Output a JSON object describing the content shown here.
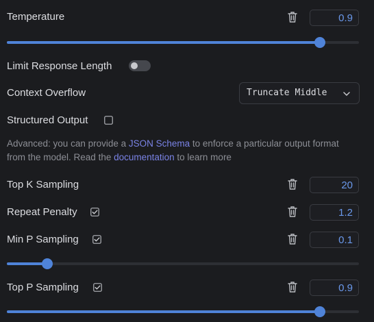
{
  "temperature": {
    "label": "Temperature",
    "value": "0.9",
    "slider_fraction": 0.89
  },
  "limit_response": {
    "label": "Limit Response Length",
    "enabled": false
  },
  "context_overflow": {
    "label": "Context Overflow",
    "selected": "Truncate Middle"
  },
  "structured_output": {
    "label": "Structured Output",
    "checked": false,
    "help_prefix": "Advanced: you can provide a ",
    "help_link1": "JSON Schema",
    "help_middle": " to enforce a particular output format from the model. Read the ",
    "help_link2": "documentation",
    "help_suffix": " to learn more"
  },
  "top_k": {
    "label": "Top K Sampling",
    "value": "20"
  },
  "repeat_penalty": {
    "label": "Repeat Penalty",
    "value": "1.2",
    "checked": true
  },
  "min_p": {
    "label": "Min P Sampling",
    "value": "0.1",
    "checked": true,
    "slider_fraction": 0.115
  },
  "top_p": {
    "label": "Top P Sampling",
    "value": "0.9",
    "checked": true,
    "slider_fraction": 0.89
  },
  "colors": {
    "accent": "#4f83d8",
    "link": "#7a83e6",
    "value_text": "#6a98ea",
    "background": "#1b1c1f"
  },
  "icons": {
    "delete": "trash-icon",
    "checkbox": "checkbox-icon",
    "dropdown": "chevron-down-icon"
  }
}
